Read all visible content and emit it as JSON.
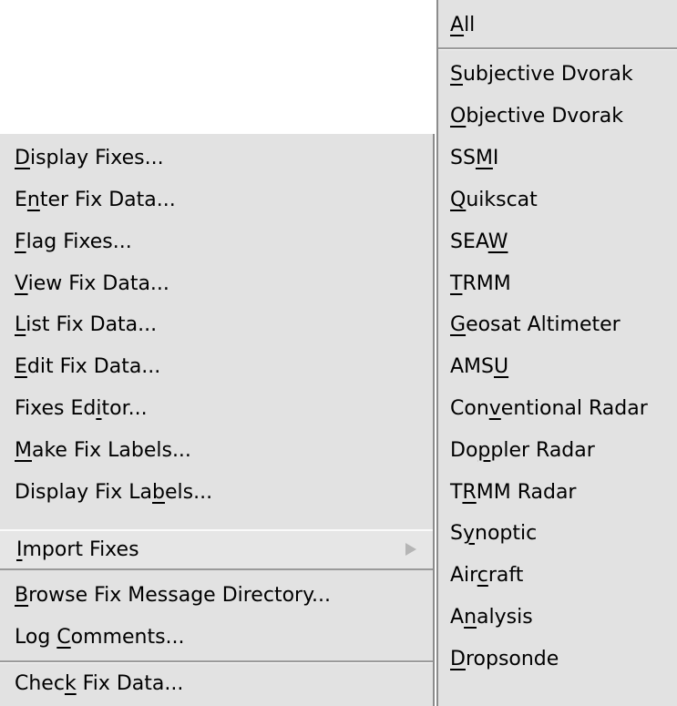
{
  "main_menu": {
    "items": [
      {
        "pre": "",
        "u": "D",
        "post": "isplay Fixes..."
      },
      {
        "pre": "E",
        "u": "n",
        "post": "ter Fix Data..."
      },
      {
        "pre": "",
        "u": "F",
        "post": "lag Fixes..."
      },
      {
        "pre": "",
        "u": "V",
        "post": "iew Fix Data..."
      },
      {
        "pre": "",
        "u": "L",
        "post": "ist Fix Data..."
      },
      {
        "pre": "",
        "u": "E",
        "post": "dit Fix Data..."
      },
      {
        "pre": "Fixes Ed",
        "u": "i",
        "post": "tor..."
      },
      {
        "pre": "",
        "u": "M",
        "post": "ake Fix Labels..."
      },
      {
        "pre": "Display Fix La",
        "u": "b",
        "post": "els..."
      },
      {
        "pre": "",
        "u": "I",
        "post": "mport Fixes"
      },
      {
        "pre": "",
        "u": "B",
        "post": "rowse Fix Message Directory..."
      },
      {
        "pre": "Log ",
        "u": "C",
        "post": "omments..."
      },
      {
        "pre": "Chec",
        "u": "k",
        "post": " Fix Data..."
      }
    ]
  },
  "sub_menu": {
    "items": [
      {
        "pre": "",
        "u": "A",
        "post": "ll"
      },
      {
        "pre": "",
        "u": "S",
        "post": "ubjective Dvorak"
      },
      {
        "pre": "",
        "u": "O",
        "post": "bjective Dvorak"
      },
      {
        "pre": "SS",
        "u": "M",
        "post": "I"
      },
      {
        "pre": "",
        "u": "Q",
        "post": "uikscat"
      },
      {
        "pre": "SEA",
        "u": "W",
        "post": ""
      },
      {
        "pre": "",
        "u": "T",
        "post": "RMM"
      },
      {
        "pre": "",
        "u": "G",
        "post": "eosat Altimeter"
      },
      {
        "pre": "AMS",
        "u": "U",
        "post": ""
      },
      {
        "pre": "Con",
        "u": "v",
        "post": "entional Radar"
      },
      {
        "pre": "Do",
        "u": "p",
        "post": "pler Radar"
      },
      {
        "pre": "T",
        "u": "R",
        "post": "MM Radar"
      },
      {
        "pre": "S",
        "u": "y",
        "post": "noptic"
      },
      {
        "pre": "Air",
        "u": "c",
        "post": "raft"
      },
      {
        "pre": "A",
        "u": "n",
        "post": "alysis"
      },
      {
        "pre": "",
        "u": "D",
        "post": "ropsonde"
      }
    ]
  },
  "icons": {
    "submenu_arrow": "triangle-right-icon"
  },
  "colors": {
    "menu_bg": "#e2e2e2",
    "shadow": "#8c8c8c",
    "highlight": "#fafafa"
  }
}
